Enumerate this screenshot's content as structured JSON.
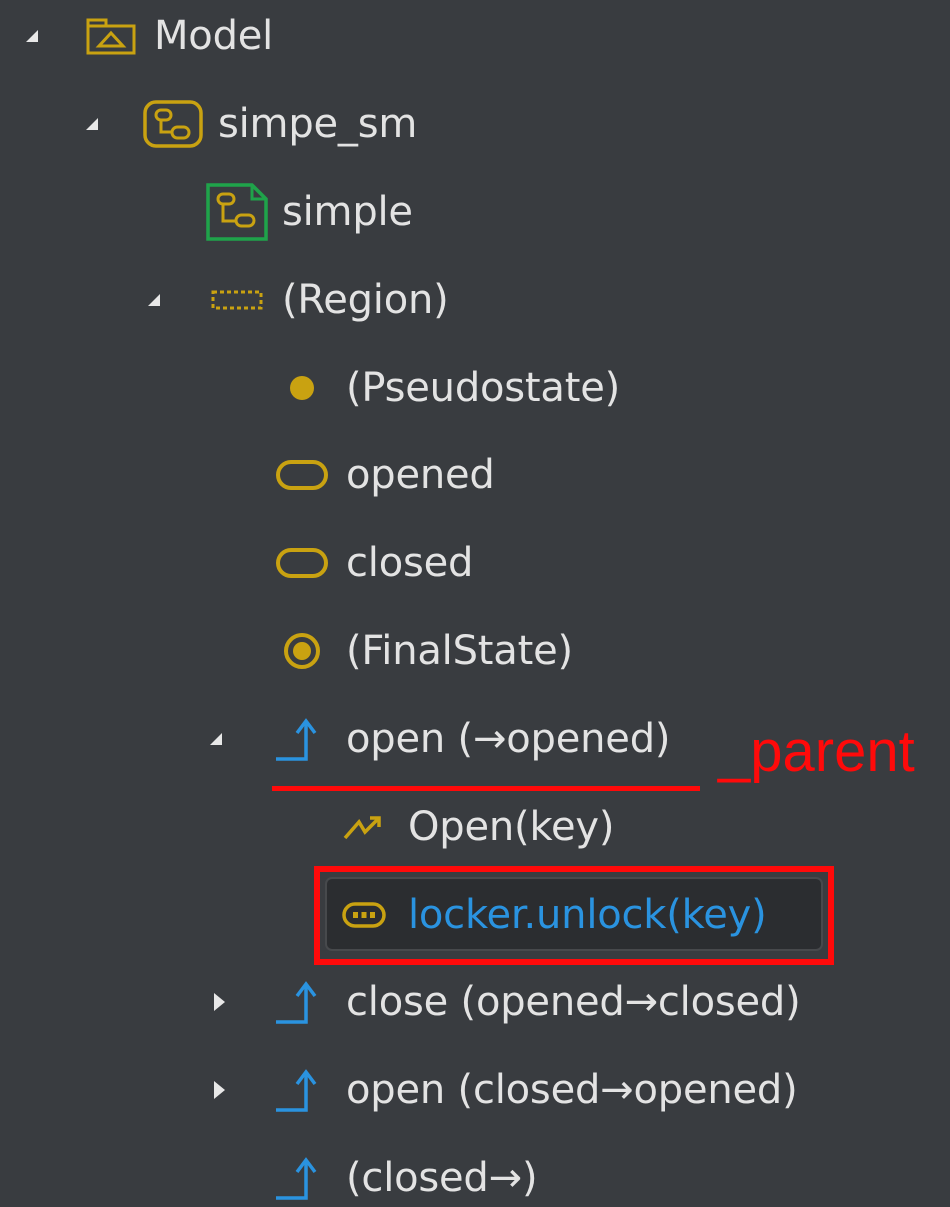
{
  "colors": {
    "background": "#393c40",
    "text": "#e3e3e3",
    "icon_gold": "#c9a211",
    "icon_green": "#1fa34a",
    "transition_blue": "#2a93e0",
    "annotation_red": "#ff0a0a",
    "selection_bg": "#2b2d30"
  },
  "tree": {
    "items": [
      {
        "label": "Model",
        "icon": "package-icon",
        "expanded": true
      },
      {
        "label": "simpe_sm",
        "icon": "state-machine-icon",
        "expanded": true
      },
      {
        "label": "simple",
        "icon": "diagram-icon"
      },
      {
        "label": "(Region)",
        "icon": "region-icon",
        "expanded": true
      },
      {
        "label": "(Pseudostate)",
        "icon": "pseudostate-icon"
      },
      {
        "label": "opened",
        "icon": "state-icon"
      },
      {
        "label": "closed",
        "icon": "state-icon"
      },
      {
        "label": "(FinalState)",
        "icon": "final-state-icon"
      },
      {
        "label": "open (→opened)",
        "icon": "transition-icon",
        "expanded": true
      },
      {
        "label": "Open(key)",
        "icon": "trigger-icon"
      },
      {
        "label": "locker.unlock(key)",
        "icon": "opaque-behavior-icon",
        "selected": true
      },
      {
        "label": "close (opened→closed)",
        "icon": "transition-icon",
        "expanded": false
      },
      {
        "label": "open (closed→opened)",
        "icon": "transition-icon",
        "expanded": false
      },
      {
        "label": "(closed→)",
        "icon": "transition-icon"
      }
    ]
  },
  "annotation": {
    "text": "_parent"
  }
}
